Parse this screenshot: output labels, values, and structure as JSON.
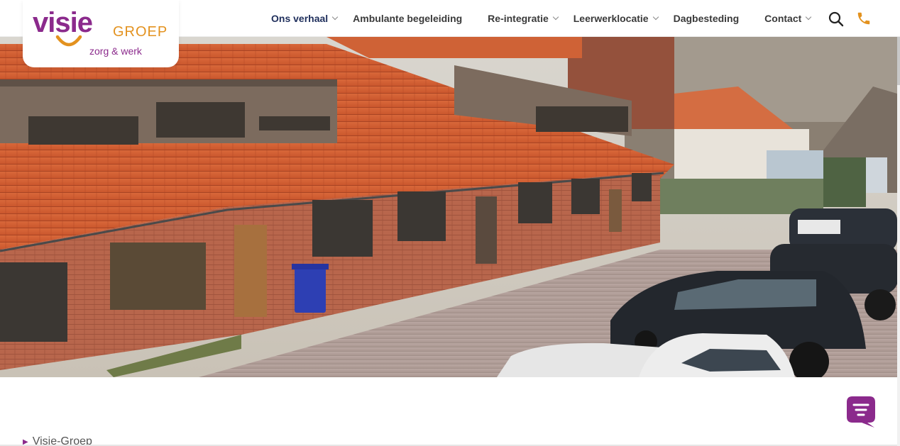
{
  "logo": {
    "word": "visie",
    "groep": "GROEP",
    "tagline": "zorg & werk"
  },
  "nav": {
    "items": [
      {
        "label": "Ons verhaal",
        "dropdown": true,
        "active": true
      },
      {
        "label": "Ambulante begeleiding",
        "dropdown": false
      },
      {
        "label": "Re-integratie",
        "dropdown": true
      },
      {
        "label": "Leerwerklocatie",
        "dropdown": true
      },
      {
        "label": "Dagbesteding",
        "dropdown": false
      },
      {
        "label": "Contact",
        "dropdown": true
      }
    ]
  },
  "icons": {
    "search": "search-icon",
    "phone": "phone-icon",
    "chat": "chat-icon"
  },
  "breadcrumb": {
    "items": [
      "Visie-Groep"
    ]
  },
  "colors": {
    "brand_purple": "#8b2a8c",
    "brand_orange": "#e3921f",
    "nav_active": "#1f2f5c"
  }
}
